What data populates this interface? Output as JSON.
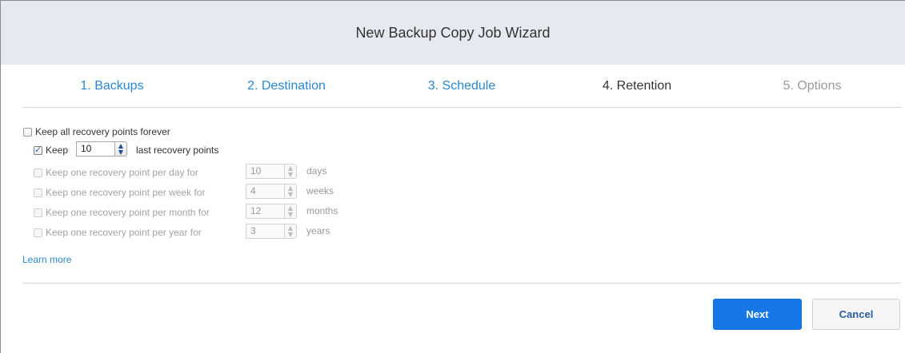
{
  "header": {
    "title": "New Backup Copy Job Wizard"
  },
  "steps": [
    {
      "label": "1. Backups",
      "state": "link"
    },
    {
      "label": "2. Destination",
      "state": "link"
    },
    {
      "label": "3. Schedule",
      "state": "link"
    },
    {
      "label": "4. Retention",
      "state": "active"
    },
    {
      "label": "5. Options",
      "state": "disabled"
    }
  ],
  "retention": {
    "keep_forever": {
      "label": "Keep all recovery points forever",
      "checked": false
    },
    "keep_last": {
      "prefix": "Keep",
      "value": "10",
      "suffix": "last recovery points",
      "checked": true
    },
    "per_day": {
      "label": "Keep one recovery point per day for",
      "value": "10",
      "unit": "days",
      "checked": false
    },
    "per_week": {
      "label": "Keep one recovery point per week for",
      "value": "4",
      "unit": "weeks",
      "checked": false
    },
    "per_month": {
      "label": "Keep one recovery point per month for",
      "value": "12",
      "unit": "months",
      "checked": false
    },
    "per_year": {
      "label": "Keep one recovery point per year for",
      "value": "3",
      "unit": "years",
      "checked": false
    }
  },
  "learn_more": "Learn more",
  "footer": {
    "next_label": "Next",
    "cancel_label": "Cancel"
  },
  "colors": {
    "accent": "#1678e6",
    "link": "#2a87cf",
    "header_bg": "#e6e9ef"
  }
}
